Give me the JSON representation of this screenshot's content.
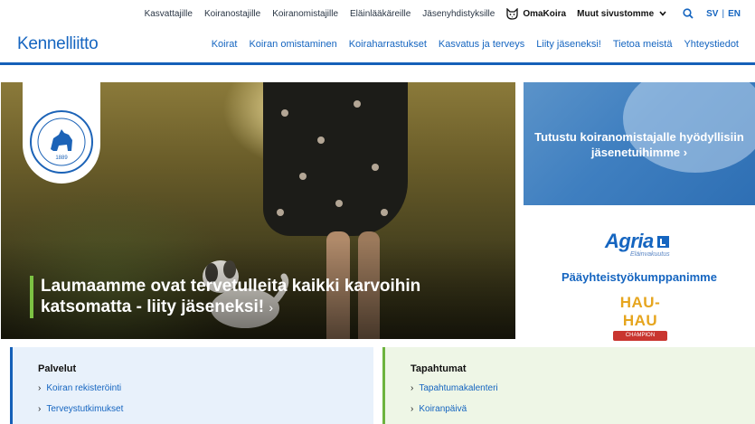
{
  "topbar": {
    "links": [
      "Kasvattajille",
      "Koiranostajille",
      "Koiranomistajille",
      "Eläinlääkäreille",
      "Jäsenyhdistyksille"
    ],
    "omakoira": "OmaKoira",
    "more": "Muut sivustomme",
    "lang_sv": "SV",
    "lang_sep": "|",
    "lang_en": "EN"
  },
  "nav": {
    "logo": "Kennelliitto",
    "links": [
      "Koirat",
      "Koiran omistaminen",
      "Koiraharrastukset",
      "Kasvatus ja terveys",
      "Liity jäseneksi!",
      "Tietoa meistä",
      "Yhteystiedot"
    ]
  },
  "hero": {
    "title": "Laumaamme ovat tervetulleita kaikki karvoihin katsomatta - liity jäseneksi!",
    "arrow": "›",
    "badge_year": "1889"
  },
  "promo": {
    "text": "Tutustu koiranomistajalle hyödyllisiin jäsenetuihimme",
    "arrow": "›"
  },
  "partner": {
    "agria": "Agria",
    "agria_sub": "Eläinvakuutus",
    "label": "Pääyhteistyökumppanimme",
    "hauhau": "HAU-HAU",
    "hauhau_sub": "CHAMPION"
  },
  "cards": {
    "services": {
      "title": "Palvelut",
      "items": [
        "Koiran rekisteröinti",
        "Terveystutkimukset"
      ]
    },
    "events": {
      "title": "Tapahtumat",
      "items": [
        "Tapahtumakalenteri",
        "Koiranpäivä"
      ]
    }
  },
  "colors": {
    "brand_blue": "#1565c0",
    "accent_green": "#7cc243"
  }
}
